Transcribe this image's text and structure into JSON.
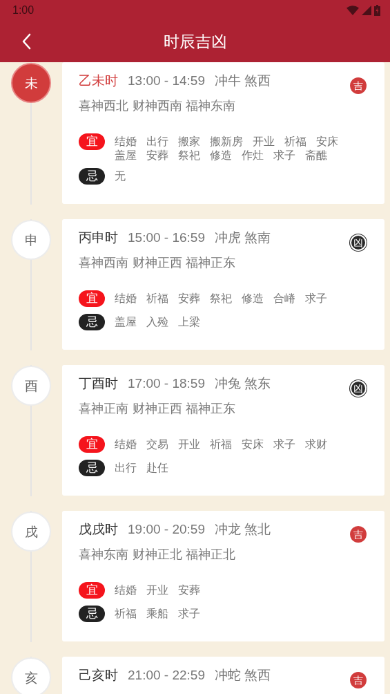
{
  "status_bar": {
    "time": "1:00"
  },
  "header": {
    "title": "时辰吉凶"
  },
  "hours": [
    {
      "branch": "未",
      "selected": true,
      "name": "乙未时",
      "time": "13:00 - 14:59",
      "clash": "冲牛 煞西",
      "luck": {
        "text": "吉",
        "kind": "good"
      },
      "gods": "喜神西北 财神西南 福神东南",
      "yi": {
        "label": "宜",
        "items": [
          "结婚",
          "出行",
          "搬家",
          "搬新房",
          "开业",
          "祈福",
          "安床",
          "盖屋",
          "安葬",
          "祭祀",
          "修造",
          "作灶",
          "求子",
          "斋醮"
        ]
      },
      "ji": {
        "label": "忌",
        "items": [
          "无"
        ]
      }
    },
    {
      "branch": "申",
      "selected": false,
      "name": "丙申时",
      "time": "15:00 - 16:59",
      "clash": "冲虎 煞南",
      "luck": {
        "text": "凶",
        "kind": "bad"
      },
      "gods": "喜神西南 财神正西 福神正东",
      "yi": {
        "label": "宜",
        "items": [
          "结婚",
          "祈福",
          "安葬",
          "祭祀",
          "修造",
          "合嵴",
          "求子"
        ]
      },
      "ji": {
        "label": "忌",
        "items": [
          "盖屋",
          "入殓",
          "上梁"
        ]
      }
    },
    {
      "branch": "酉",
      "selected": false,
      "name": "丁酉时",
      "time": "17:00 - 18:59",
      "clash": "冲兔 煞东",
      "luck": {
        "text": "凶",
        "kind": "bad"
      },
      "gods": "喜神正南 财神正西 福神正东",
      "yi": {
        "label": "宜",
        "items": [
          "结婚",
          "交易",
          "开业",
          "祈福",
          "安床",
          "求子",
          "求财"
        ]
      },
      "ji": {
        "label": "忌",
        "items": [
          "出行",
          "赴任"
        ]
      }
    },
    {
      "branch": "戌",
      "selected": false,
      "name": "戊戌时",
      "time": "19:00 - 20:59",
      "clash": "冲龙 煞北",
      "luck": {
        "text": "吉",
        "kind": "good"
      },
      "gods": "喜神东南 财神正北 福神正北",
      "yi": {
        "label": "宜",
        "items": [
          "结婚",
          "开业",
          "安葬"
        ]
      },
      "ji": {
        "label": "忌",
        "items": [
          "祈福",
          "乘船",
          "求子"
        ]
      }
    },
    {
      "branch": "亥",
      "selected": false,
      "name": "己亥时",
      "time": "21:00 - 22:59",
      "clash": "冲蛇 煞西",
      "luck": {
        "text": "吉",
        "kind": "good"
      }
    }
  ]
}
